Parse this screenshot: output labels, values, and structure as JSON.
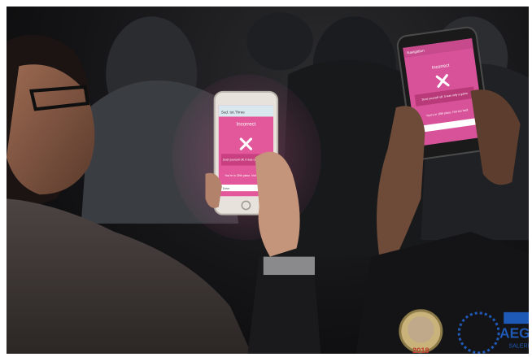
{
  "phone_left": {
    "app_bar": "Sud. tot.Three",
    "status": "Incorrect",
    "message": "Dust yourself off, it was only a game",
    "footer": "You're in 25th place. Not too bad!",
    "input_hint": "Enter",
    "colors": {
      "screen": "#e3589a",
      "bar": "#d9e7ef"
    }
  },
  "phone_right": {
    "app_bar": "Navigation",
    "status": "Incorrect",
    "message": "Dust yourself off, it was only a game",
    "footer": "You're in 18th place. Not too bad!",
    "colors": {
      "screen": "#d8529a"
    }
  },
  "logos": {
    "medal_text": "2018",
    "aegee_name": "AEGEE",
    "aegee_city": "SALERNO",
    "colors": {
      "aegee_blue": "#1f59b6",
      "medal_red": "#c0392b"
    }
  }
}
